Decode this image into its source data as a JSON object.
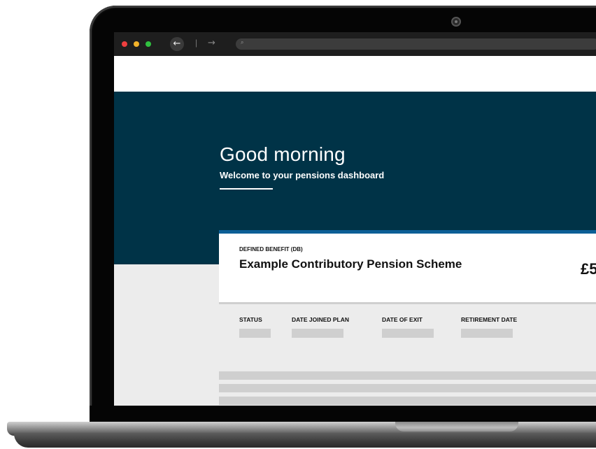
{
  "browser": {
    "back_icon": "←",
    "separator": "|",
    "forward_icon": "→",
    "search_icon": "⌕"
  },
  "hero": {
    "greeting": "Good morning",
    "subtitle": "Welcome to your pensions dashboard"
  },
  "card": {
    "type_label": "DEFINED BENEFIT (DB)",
    "title": "Example Contributory Pension Scheme",
    "amount_partial": "£5"
  },
  "details": {
    "columns": [
      "STATUS",
      "DATE JOINED PLAN",
      "DATE OF EXIT",
      "RETIREMENT DATE"
    ]
  },
  "colors": {
    "hero_bg": "#003347",
    "card_accent": "#0c5f96",
    "placeholder": "#cfcfcf"
  }
}
